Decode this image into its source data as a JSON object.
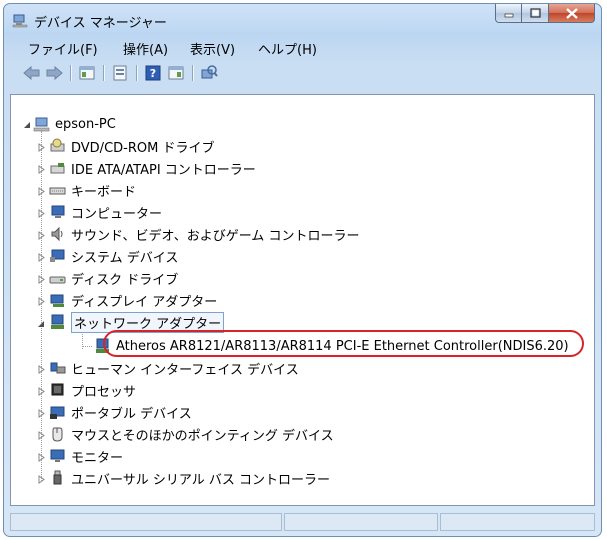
{
  "window": {
    "title": "デバイス マネージャー"
  },
  "menubar": {
    "items": [
      {
        "label": "ファイル(F)"
      },
      {
        "label": "操作(A)"
      },
      {
        "label": "表示(V)"
      },
      {
        "label": "ヘルプ(H)"
      }
    ]
  },
  "toolbar": {
    "buttons": [
      "back-arrow-icon",
      "forward-arrow-icon",
      "console-tree-icon",
      "properties-icon",
      "help-icon",
      "action-pane-icon",
      "scan-hardware-icon"
    ]
  },
  "tree": {
    "root": {
      "label": "epson-PC",
      "expanded": true
    },
    "items": [
      {
        "label": "DVD/CD-ROM ドライブ",
        "icon": "dvd-drive-icon"
      },
      {
        "label": "IDE ATA/ATAPI コントローラー",
        "icon": "ide-controller-icon"
      },
      {
        "label": "キーボード",
        "icon": "keyboard-icon"
      },
      {
        "label": "コンピューター",
        "icon": "computer-icon"
      },
      {
        "label": "サウンド、ビデオ、およびゲーム コントローラー",
        "icon": "sound-icon"
      },
      {
        "label": "システム デバイス",
        "icon": "system-device-icon"
      },
      {
        "label": "ディスク ドライブ",
        "icon": "disk-drive-icon"
      },
      {
        "label": "ディスプレイ アダプター",
        "icon": "display-adapter-icon"
      },
      {
        "label": "ネットワーク アダプター",
        "icon": "network-adapter-icon",
        "expanded": true
      },
      {
        "label": "Atheros AR8121/AR8113/AR8114 PCI-E Ethernet Controller(NDIS6.20)",
        "icon": "network-card-icon",
        "child": true
      },
      {
        "label": "ヒューマン インターフェイス デバイス",
        "icon": "hid-icon"
      },
      {
        "label": "プロセッサ",
        "icon": "processor-icon"
      },
      {
        "label": "ポータブル デバイス",
        "icon": "portable-device-icon"
      },
      {
        "label": "マウスとそのほかのポインティング デバイス",
        "icon": "mouse-icon"
      },
      {
        "label": "モニター",
        "icon": "monitor-icon"
      },
      {
        "label": "ユニバーサル シリアル バス コントローラー",
        "icon": "usb-icon"
      }
    ]
  },
  "colors": {
    "highlight": "#d8232a",
    "titlebar": "#c9def3",
    "selection_border": "#7da2ce"
  }
}
